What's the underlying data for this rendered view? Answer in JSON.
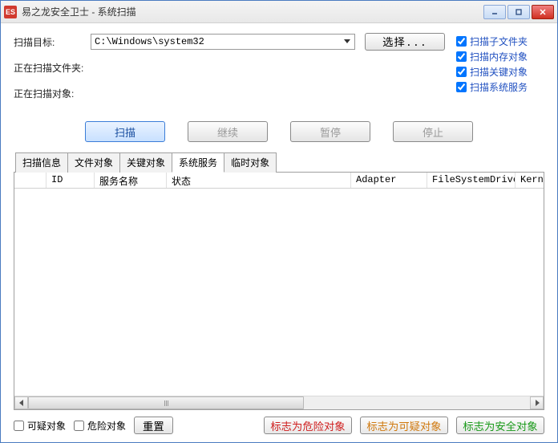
{
  "app_icon_text": "ES",
  "window_title": "易之龙安全卫士 - 系统扫描",
  "fields": {
    "target_label": "扫描目标:",
    "target_value": "C:\\Windows\\system32",
    "select_button": "选择...",
    "scanning_folder_label": "正在扫描文件夹:",
    "scanning_object_label": "正在扫描对象:"
  },
  "options": {
    "subfolders": "扫描子文件夹",
    "memory": "扫描内存对象",
    "critical": "扫描关键对象",
    "services": "扫描系统服务"
  },
  "actions": {
    "scan": "扫描",
    "continue": "继续",
    "pause": "暂停",
    "stop": "停止"
  },
  "tabs": [
    "扫描信息",
    "文件对象",
    "关键对象",
    "系统服务",
    "临时对象"
  ],
  "columns": [
    "",
    "ID",
    "服务名称",
    "状态",
    "Adapter",
    "FileSystemDriver",
    "KernelDri"
  ],
  "bottom": {
    "suspicious": "可疑对象",
    "dangerous": "危险对象",
    "reset": "重置",
    "mark_dangerous": "标志为危险对象",
    "mark_suspicious": "标志为可疑对象",
    "mark_safe": "标志为安全对象"
  }
}
